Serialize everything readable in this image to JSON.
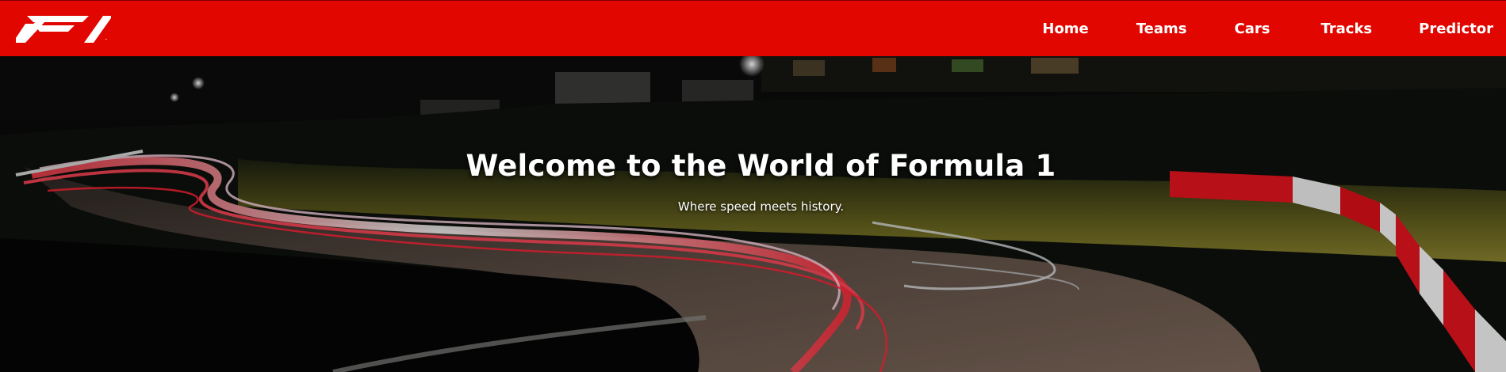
{
  "brand": {
    "logo_icon": "f1-logo-icon",
    "accent_color": "#e10600"
  },
  "nav": {
    "items": [
      {
        "label": "Home"
      },
      {
        "label": "Teams"
      },
      {
        "label": "Cars"
      },
      {
        "label": "Tracks"
      },
      {
        "label": "Predictor"
      }
    ]
  },
  "hero": {
    "title": "Welcome to the World of Formula 1",
    "subtitle": "Where speed meets history.",
    "background": "night race track light trails photo"
  }
}
